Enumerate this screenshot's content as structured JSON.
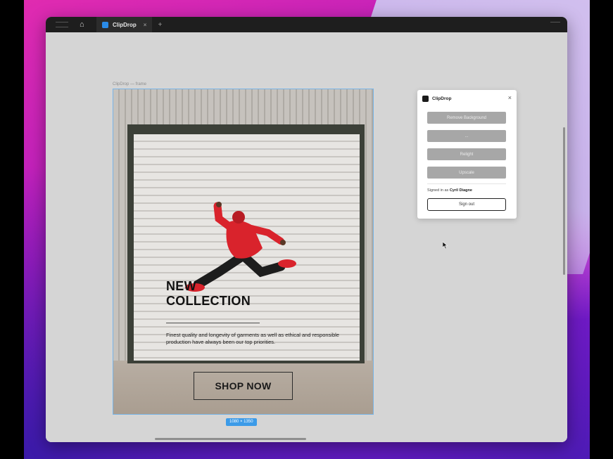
{
  "app": {
    "tab_title": "ClipDrop",
    "tab_close": "×",
    "tab_add": "+",
    "home_icon": "home-icon"
  },
  "canvas": {
    "frame_label": "ClipDrop — frame",
    "size_badge": "1080 × 1350"
  },
  "ad": {
    "headline_line1": "NEW",
    "headline_line2": "COLLECTION",
    "body": "Finest quality and longevity of garments as well as ethical and responsible production have always been our top priorities.",
    "cta": "SHOP NOW"
  },
  "plugin": {
    "title": "ClipDrop",
    "close": "×",
    "buttons": [
      "Remove Background",
      "...",
      "Relight",
      "Upscale"
    ],
    "signed_prefix": "Signed in as",
    "signed_user": "Cyril Diagne",
    "sign_out": "Sign out"
  },
  "colors": {
    "accent": "#3c9be8",
    "plugin_button": "#a7a7a7",
    "hoodie": "#d9232c"
  }
}
